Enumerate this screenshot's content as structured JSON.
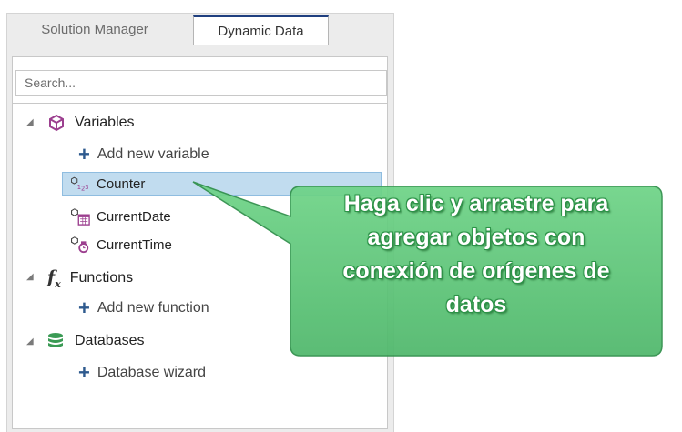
{
  "tabs": [
    {
      "label": "Solution Manager",
      "active": false
    },
    {
      "label": "Dynamic Data",
      "active": true
    }
  ],
  "search": {
    "placeholder": "Search..."
  },
  "tree": {
    "variables": {
      "label": "Variables",
      "add_label": "Add new variable",
      "items": [
        {
          "label": "Counter",
          "icon": "counter-variable-icon",
          "selected": true
        },
        {
          "label": "CurrentDate",
          "icon": "date-variable-icon",
          "selected": false
        },
        {
          "label": "CurrentTime",
          "icon": "time-variable-icon",
          "selected": false
        }
      ]
    },
    "functions": {
      "label": "Functions",
      "add_label": "Add new function"
    },
    "databases": {
      "label": "Databases",
      "add_label": "Database wizard"
    }
  },
  "callout": {
    "lines": [
      "Haga clic y arrastre para",
      "agregar objetos con",
      "conexión de orígenes de",
      "datos"
    ]
  },
  "colors": {
    "accent_tab": "#1f3f7f",
    "selection": "#c1dcef",
    "callout_fill": "#5fc77a",
    "plus": "#2e5a8e"
  }
}
